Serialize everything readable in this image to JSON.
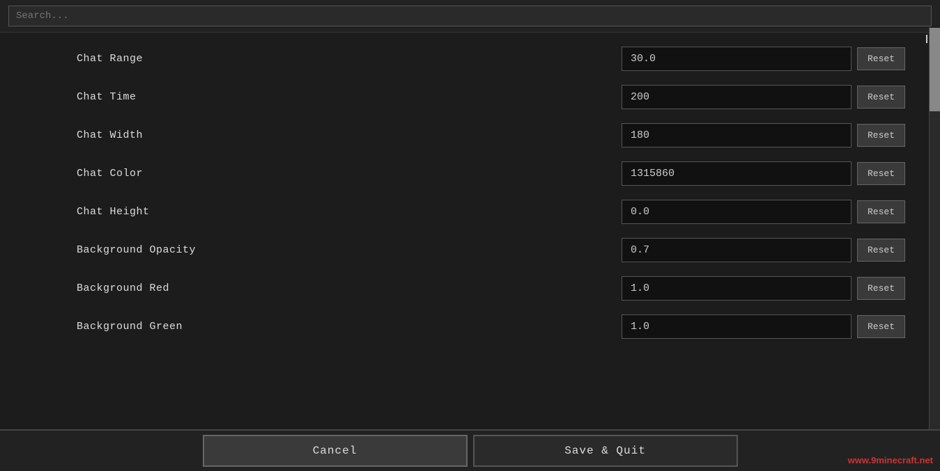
{
  "search": {
    "placeholder": "Search...",
    "value": ""
  },
  "settings": {
    "rows": [
      {
        "id": "chat-range",
        "label": "Chat Range",
        "value": "30.0"
      },
      {
        "id": "chat-time",
        "label": "Chat Time",
        "value": "200"
      },
      {
        "id": "chat-width",
        "label": "Chat Width",
        "value": "180"
      },
      {
        "id": "chat-color",
        "label": "Chat Color",
        "value": "1315860"
      },
      {
        "id": "chat-height",
        "label": "Chat Height",
        "value": "0.0"
      },
      {
        "id": "background-opacity",
        "label": "Background Opacity",
        "value": "0.7"
      },
      {
        "id": "background-red",
        "label": "Background Red",
        "value": "1.0"
      },
      {
        "id": "background-green",
        "label": "Background Green",
        "value": "1.0"
      }
    ],
    "reset_label": "Reset"
  },
  "buttons": {
    "cancel": "Cancel",
    "save_quit": "Save & Quit"
  },
  "watermark": "www.9minecraft.net"
}
